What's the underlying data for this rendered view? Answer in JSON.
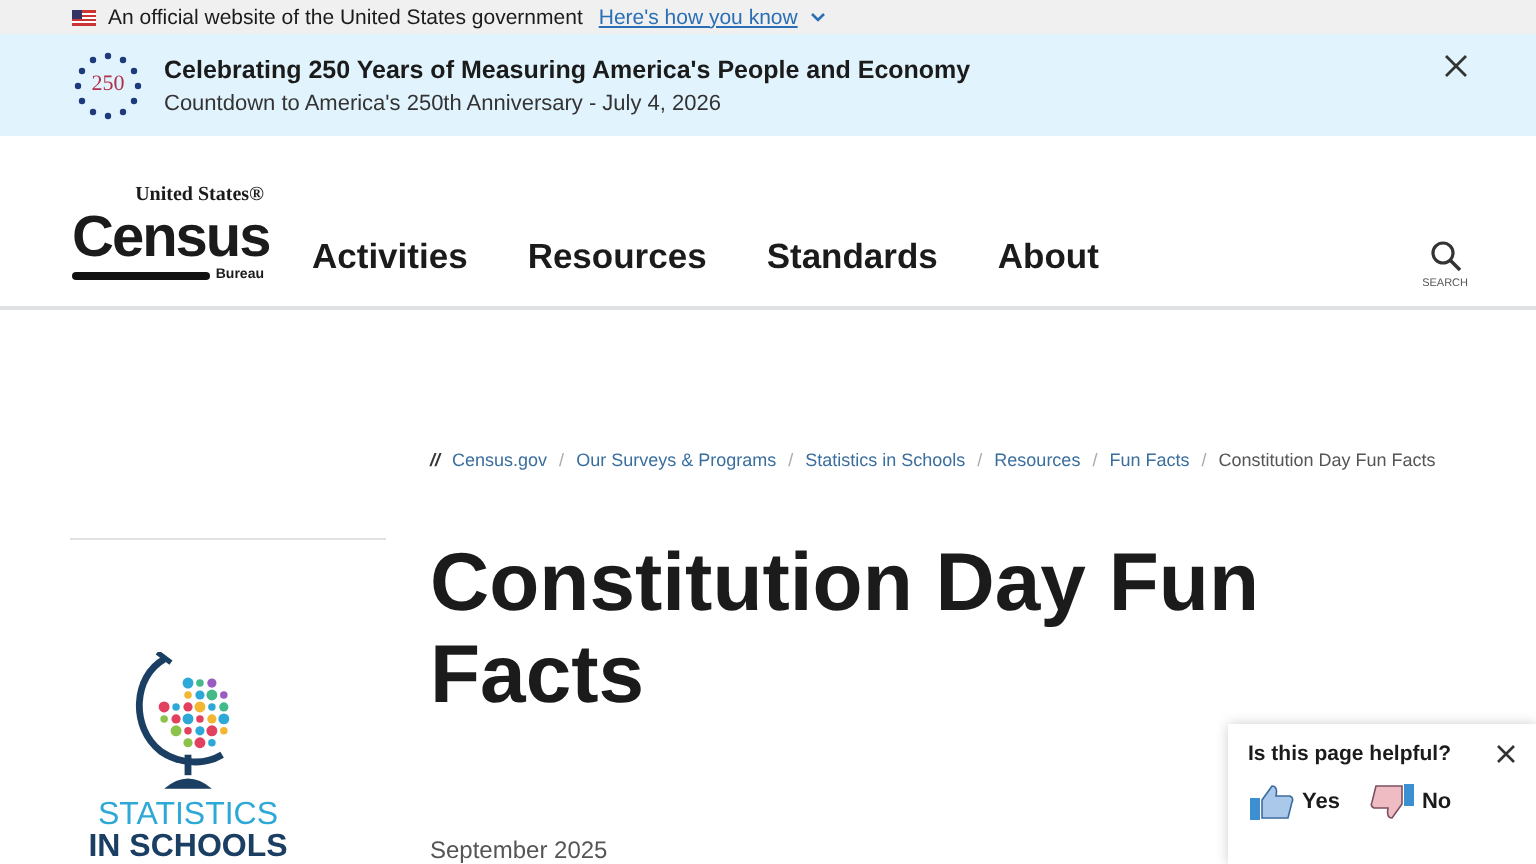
{
  "gov_banner": {
    "text": "An official website of the United States government",
    "link": "Here's how you know"
  },
  "announcement": {
    "emblem_text": "250",
    "title": "Celebrating 250 Years of Measuring America's People and Economy",
    "subtitle": "Countdown to America's 250th Anniversary - July 4, 2026"
  },
  "header": {
    "logo": {
      "top": "United States®",
      "main": "Census",
      "bottom": "Bureau"
    },
    "nav": [
      "Activities",
      "Resources",
      "Standards",
      "About"
    ],
    "search_label": "SEARCH"
  },
  "breadcrumb": {
    "lead": "//",
    "separator": "/",
    "items": [
      {
        "label": "Census.gov",
        "current": false
      },
      {
        "label": "Our Surveys & Programs",
        "current": false
      },
      {
        "label": "Statistics in Schools",
        "current": false
      },
      {
        "label": "Resources",
        "current": false
      },
      {
        "label": "Fun Facts",
        "current": false
      },
      {
        "label": "Constitution Day Fun Facts",
        "current": true
      }
    ]
  },
  "page": {
    "title": "Constitution Day Fun Facts",
    "date": "September 2025"
  },
  "sidebar": {
    "logo_line1": "STATISTICS",
    "logo_line2": "IN SCHOOLS"
  },
  "feedback": {
    "question": "Is this page helpful?",
    "yes": "Yes",
    "no": "No"
  }
}
